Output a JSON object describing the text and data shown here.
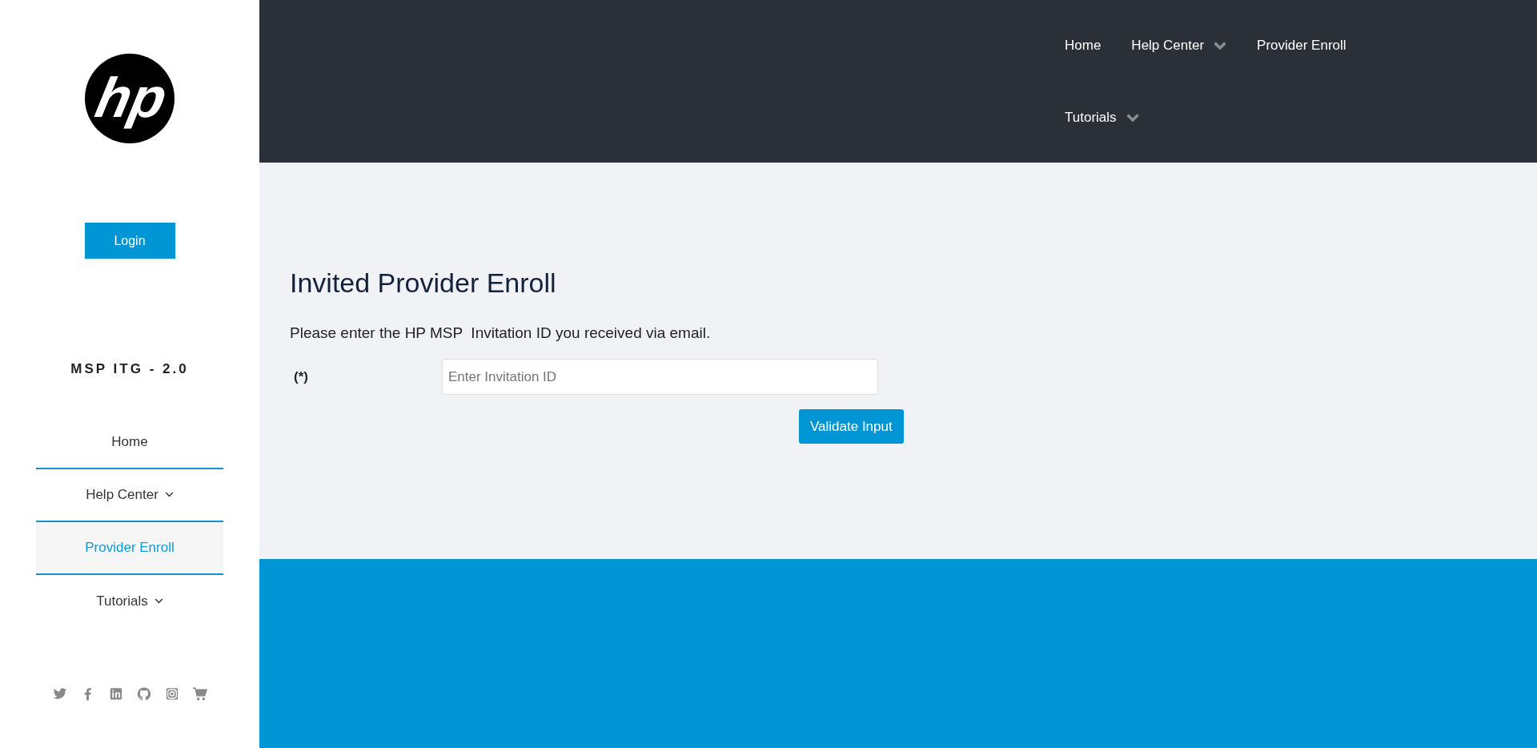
{
  "sidebar": {
    "logo": {
      "text": "hp"
    },
    "login_button": "Login",
    "brand": "MSP ITG - 2.0",
    "items": [
      {
        "label": "Home",
        "selected": false,
        "dropdown": false
      },
      {
        "label": "Help Center",
        "selected": false,
        "dropdown": true
      },
      {
        "label": "Provider Enroll",
        "selected": true,
        "dropdown": false
      },
      {
        "label": "Tutorials",
        "selected": false,
        "dropdown": true
      }
    ],
    "social": [
      {
        "kind": "bird"
      },
      {
        "kind": "f"
      },
      {
        "kind": "in"
      },
      {
        "kind": "cat"
      },
      {
        "kind": "camera"
      },
      {
        "kind": "cart"
      }
    ]
  },
  "top_nav": [
    {
      "label": "Home",
      "dropdown": false
    },
    {
      "label": "Help Center",
      "dropdown": true
    },
    {
      "label": "Provider Enroll",
      "dropdown": false
    },
    {
      "label": "Tutorials",
      "dropdown": true
    }
  ],
  "form": {
    "title": "Invited Provider Enroll",
    "instruction": "Please enter the HP MSP  Invitation ID you received via email.",
    "required_label": "(*)",
    "placeholder": "Enter Invitation ID",
    "submit": "Validate Input"
  }
}
